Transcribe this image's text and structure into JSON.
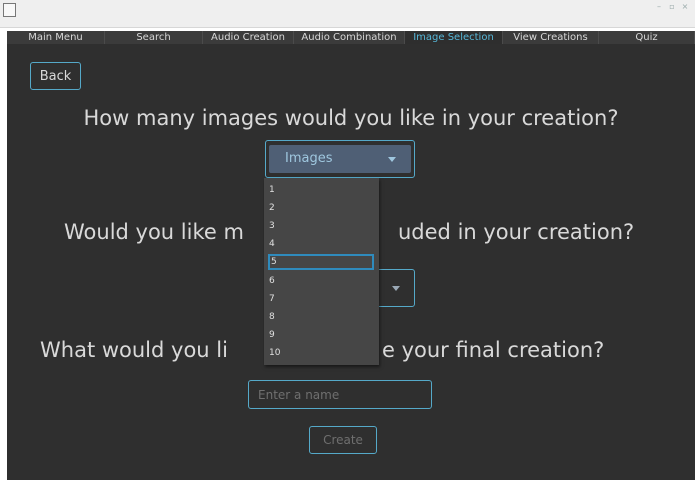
{
  "window": {
    "icon": "app-window-icon",
    "controls": [
      "minimize-icon",
      "maximize-icon",
      "close-icon"
    ]
  },
  "tabs": [
    {
      "label": "Main Menu"
    },
    {
      "label": "Search"
    },
    {
      "label": "Audio Creation"
    },
    {
      "label": "Audio Combination"
    },
    {
      "label": "Image Selection",
      "selected": true
    },
    {
      "label": "View Creations"
    },
    {
      "label": "Quiz"
    }
  ],
  "back_button": {
    "label": "Back"
  },
  "questions": {
    "q1": "How many images would you like in your creation?",
    "q2_left": "Would you like m",
    "q2_right": "uded in your creation?",
    "q3_left": "What would you li",
    "q3_right": "e your final creation?"
  },
  "images_combo": {
    "selected": "Images",
    "options": [
      "1",
      "2",
      "3",
      "4",
      "5",
      "6",
      "7",
      "8",
      "9",
      "10"
    ],
    "highlighted": "5"
  },
  "name_input": {
    "placeholder": "Enter a name",
    "value": ""
  },
  "create_button": {
    "label": "Create"
  },
  "colors": {
    "accent": "#55a9c9",
    "selected_tab_text": "#57b7d8",
    "background": "#2f2f2f",
    "combo_fill": "#4f5f75"
  }
}
